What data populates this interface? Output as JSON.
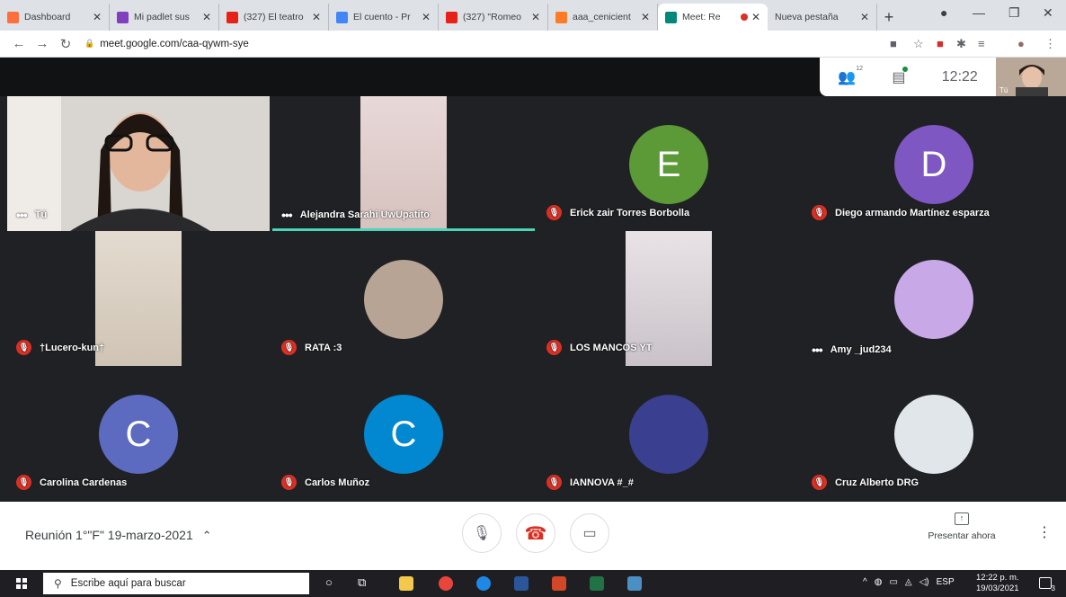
{
  "browser": {
    "tabs": [
      {
        "title": "Dashboard",
        "icon": "dashboard-favicon",
        "color": "#ff6f3c"
      },
      {
        "title": "Mi padlet sus",
        "icon": "padlet-favicon",
        "color": "#7f3fbf"
      },
      {
        "title": "(327) El teatro",
        "icon": "youtube-favicon",
        "color": "#e62117"
      },
      {
        "title": "El cuento - Pr",
        "icon": "google-favicon",
        "color": "#4285f4"
      },
      {
        "title": "(327) \"Romeo",
        "icon": "youtube-favicon",
        "color": "#e62117"
      },
      {
        "title": "aaa_cenicient",
        "icon": "canva-favicon",
        "color": "#ff7b25"
      },
      {
        "title": "Meet: Re",
        "icon": "meet-favicon",
        "color": "#00897b"
      },
      {
        "title": "Nueva pestaña",
        "icon": "blank-favicon",
        "color": "#ffffff"
      }
    ],
    "url": "meet.google.com/caa-qywm-sye"
  },
  "meet": {
    "participant_count": "12",
    "clock": "12:22",
    "self_label": "Tú",
    "accent": "#4cd5b8",
    "participants": [
      {
        "name": "Tú",
        "status": "dots",
        "kind": "camera-self"
      },
      {
        "name": "Alejandra Sarahi UwUpatito",
        "status": "dots",
        "kind": "camera-paper",
        "speaking": true
      },
      {
        "name": "Erick zair Torres Borbolla",
        "status": "muted",
        "kind": "initial",
        "initial": "E",
        "color": "#5b9a37"
      },
      {
        "name": "Diego armando Martínez esparza",
        "status": "muted",
        "kind": "initial",
        "initial": "D",
        "color": "#7e57c2"
      },
      {
        "name": "†Lucero-kun†",
        "status": "muted",
        "kind": "camera-paper"
      },
      {
        "name": "RATA :3",
        "status": "muted",
        "kind": "photo",
        "color": "#b8a494"
      },
      {
        "name": "LOS MANCOS YT",
        "status": "muted",
        "kind": "camera-paper"
      },
      {
        "name": "Amy _jud234",
        "status": "dots",
        "kind": "photo",
        "color": "#c9a8e8"
      },
      {
        "name": "Carolina Cardenas",
        "status": "muted",
        "kind": "initial",
        "initial": "C",
        "color": "#5c6bc0"
      },
      {
        "name": "Carlos Muñoz",
        "status": "muted",
        "kind": "initial",
        "initial": "C",
        "color": "#0288d1"
      },
      {
        "name": "IANNOVA #_#",
        "status": "muted",
        "kind": "photo",
        "color": "#3a3f8f"
      },
      {
        "name": "Cruz Alberto DRG",
        "status": "muted",
        "kind": "photo",
        "color": "#e0e6ea"
      }
    ],
    "meeting_title": "Reunión 1°\"F\" 19-marzo-2021",
    "present_label": "Presentar ahora"
  },
  "taskbar": {
    "search_placeholder": "Escribe aquí para buscar",
    "language": "ESP",
    "time": "12:22 p. m.",
    "date": "19/03/2021",
    "notifications": "3"
  }
}
